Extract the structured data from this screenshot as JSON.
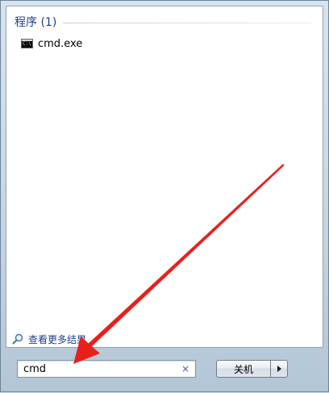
{
  "results": {
    "group_title": "程序 (1)",
    "items": [
      {
        "label": "cmd.exe",
        "icon": "cmd-console-icon",
        "icon_text": "C:\\"
      }
    ]
  },
  "see_more": {
    "label": "查看更多结果",
    "icon": "search-icon"
  },
  "search": {
    "value": "cmd",
    "clear_symbol": "×"
  },
  "shutdown": {
    "label": "关机",
    "arrow_icon": "chevron-right-icon"
  },
  "colors": {
    "link": "#1e3d8f",
    "annotation_arrow": "#e8201c",
    "panel": "#ffffff",
    "frame": "#c3d4e2"
  }
}
